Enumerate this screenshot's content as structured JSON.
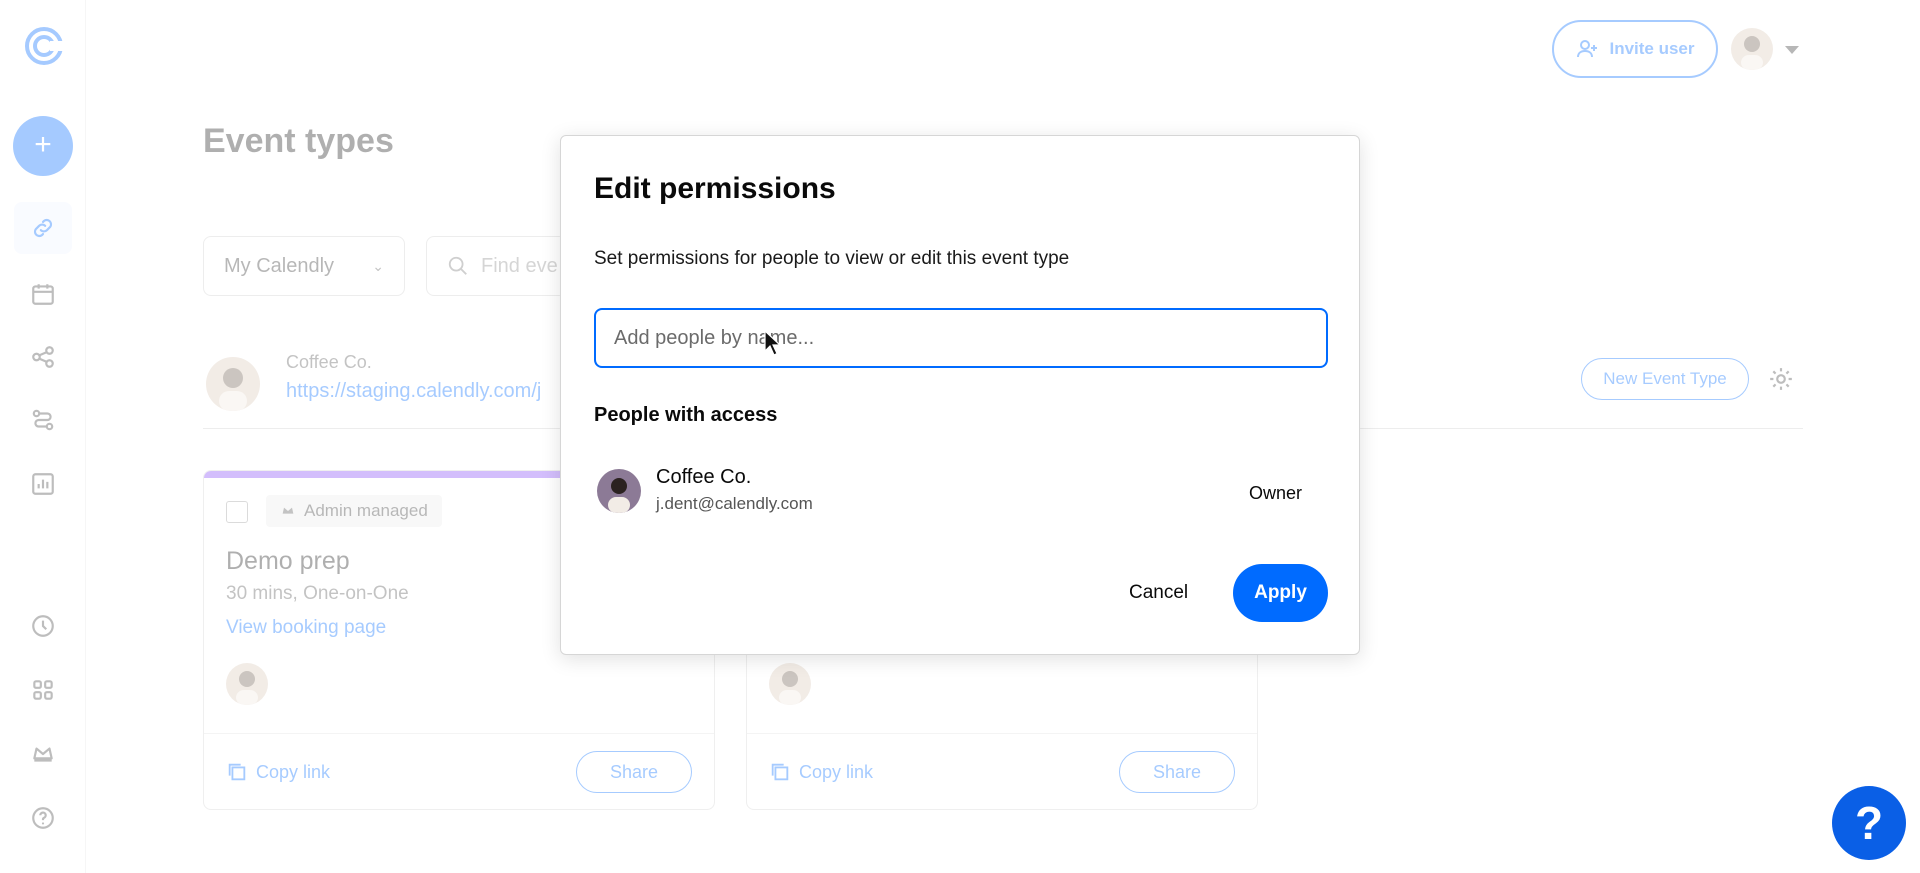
{
  "sidebar": {
    "create_label": "+",
    "items": [
      {
        "name": "event-types",
        "icon": "link-icon"
      },
      {
        "name": "scheduled-events",
        "icon": "calendar-icon"
      },
      {
        "name": "workflows",
        "icon": "share-nodes-icon"
      },
      {
        "name": "routing",
        "icon": "route-icon"
      },
      {
        "name": "analytics",
        "icon": "bar-chart-icon"
      },
      {
        "name": "availability",
        "icon": "clock-icon"
      },
      {
        "name": "integrations",
        "icon": "apps-grid-icon"
      },
      {
        "name": "admin-center",
        "icon": "crown-icon"
      },
      {
        "name": "help",
        "icon": "question-circle-icon"
      }
    ]
  },
  "header": {
    "invite_label": "Invite user"
  },
  "page": {
    "title": "Event types",
    "filter_value": "My Calendly",
    "search_placeholder": "Find eve",
    "owner_name": "Coffee Co.",
    "owner_url": "https://staging.calendly.com/j",
    "new_event_label": "New Event Type"
  },
  "cards": [
    {
      "badge": "Admin managed",
      "title": "Demo prep",
      "subtitle": "30 mins, One-on-One",
      "link": "View booking page",
      "copy_label": "Copy link",
      "share_label": "Share"
    },
    {
      "copy_label": "Copy link",
      "share_label": "Share"
    }
  ],
  "modal": {
    "title": "Edit permissions",
    "description": "Set permissions for people to view or edit this event type",
    "input_placeholder": "Add people by name...",
    "access_title": "People with access",
    "member": {
      "name": "Coffee Co.",
      "email": "j.dent@calendly.com",
      "role": "Owner"
    },
    "cancel_label": "Cancel",
    "apply_label": "Apply"
  },
  "help_fab": "?",
  "colors": {
    "accent": "#006bff",
    "card_topbar": "#8247f5"
  }
}
